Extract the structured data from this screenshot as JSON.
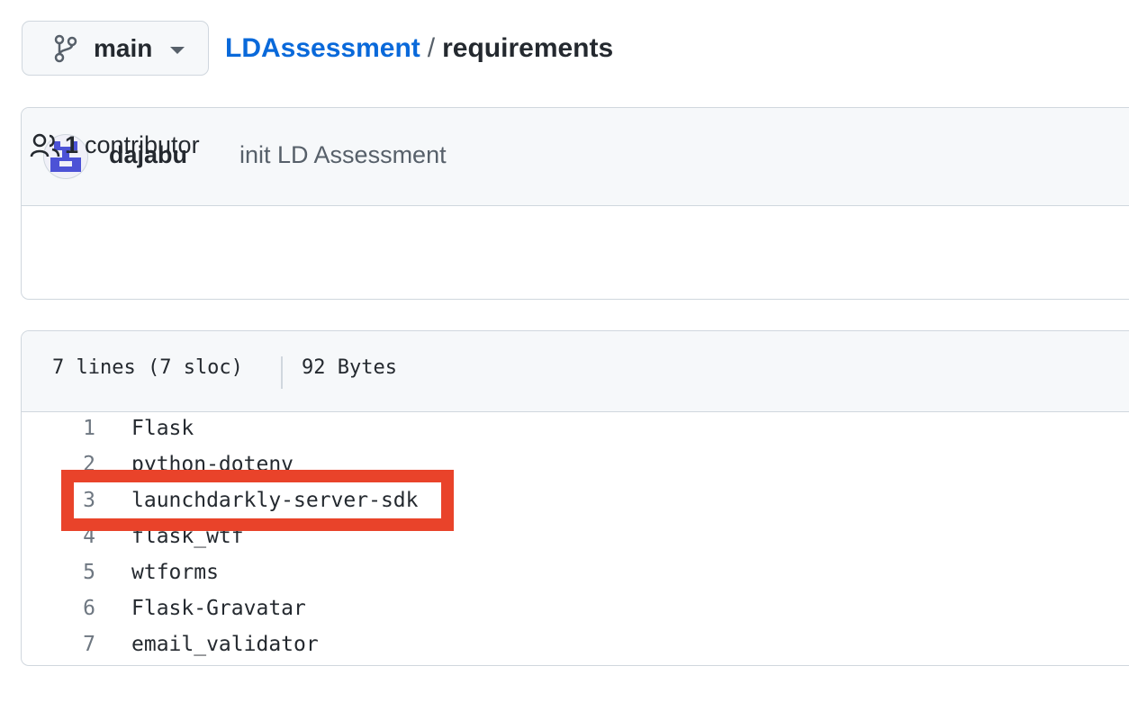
{
  "branch": {
    "name": "main",
    "icon": "git-branch-icon"
  },
  "breadcrumb": {
    "repo": "LDAssessment",
    "separator": "/",
    "file": "requirements"
  },
  "commit": {
    "author": "dajabu",
    "message": "init LD Assessment"
  },
  "contributors": {
    "count": "1",
    "label": "contributor",
    "icon": "people-icon"
  },
  "file_info": {
    "lines": "7 lines (7 sloc)",
    "size": "92 Bytes"
  },
  "code_lines": [
    {
      "num": "1",
      "text": "Flask"
    },
    {
      "num": "2",
      "text": "python-dotenv"
    },
    {
      "num": "3",
      "text": "launchdarkly-server-sdk"
    },
    {
      "num": "4",
      "text": "flask_wtf"
    },
    {
      "num": "5",
      "text": "wtforms"
    },
    {
      "num": "6",
      "text": "Flask-Gravatar"
    },
    {
      "num": "7",
      "text": "email_validator"
    }
  ],
  "highlighted_line": "3",
  "colors": {
    "link": "#0969da",
    "highlight": "#e9432a",
    "avatar": "#4c52d6"
  }
}
